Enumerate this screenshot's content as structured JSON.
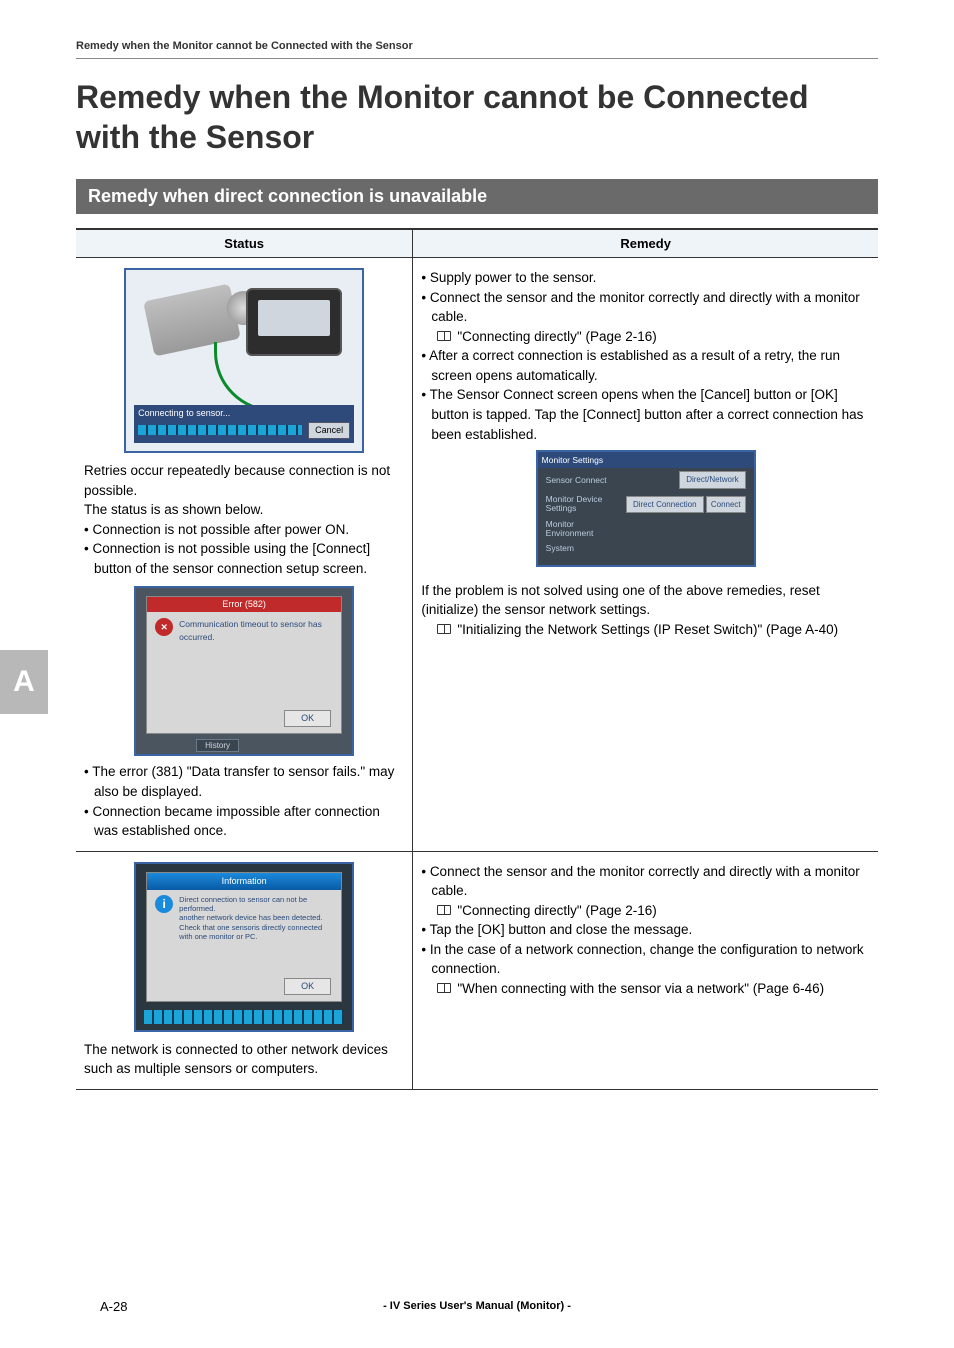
{
  "running_head": "Remedy when the Monitor cannot be Connected with the Sensor",
  "title": "Remedy when the Monitor cannot be Connected with the Sensor",
  "section": "Remedy when direct connection is unavailable",
  "table": {
    "head_status": "Status",
    "head_remedy": "Remedy"
  },
  "row1": {
    "illus1": {
      "connecting": "Connecting to sensor...",
      "cancel": "Cancel"
    },
    "status_p1": "Retries occur repeatedly because connection is not possible.",
    "status_p2": "The status is as shown below.",
    "status_b1": "Connection is not possible after power ON.",
    "status_b2": "Connection is not possible using the [Connect] button of the sensor connection setup screen.",
    "illus2": {
      "title": "Error (582)",
      "msg": "Communication timeout to sensor has occurred.",
      "ok": "OK",
      "history": "History"
    },
    "status_b3": "The error (381) \"Data transfer to sensor fails.\" may also be displayed.",
    "status_b4": "Connection became impossible after connection was established once.",
    "remedy_b1": "Supply power to the sensor.",
    "remedy_b2": "Connect the sensor and the monitor correctly and directly with a monitor cable.",
    "remedy_ref1": "\"Connecting directly\" (Page 2-16)",
    "remedy_b3": "After a correct connection is established as a result of a retry, the run screen opens automatically.",
    "remedy_b4": "The Sensor Connect screen opens when the [Cancel] button or [OK] button is tapped. Tap the [Connect] button after a correct connection has been established.",
    "mset": {
      "title": "Monitor Settings",
      "r1_lbl": "Sensor Connect",
      "r1_val": "Direct/Network",
      "r2_lbl": "Monitor Device Settings",
      "r2_val": "Direct Connection",
      "r2_btn": "Connect",
      "r3_lbl": "Monitor Environment",
      "r4_lbl": "System"
    },
    "remedy_p2": "If the problem is not solved using one of the above remedies, reset (initialize) the sensor network settings.",
    "remedy_ref2": "\"Initializing the Network Settings (IP Reset Switch)\" (Page A-40)"
  },
  "row2": {
    "illus3": {
      "title": "Information",
      "msg": "Direct connection to sensor can not be performed.\nanother network device has been detected.\nCheck that one sensoris directly connected with one monitor or PC.",
      "ok": "OK"
    },
    "status_p1": "The network is connected to other network devices such as multiple sensors or computers.",
    "remedy_b1": "Connect the sensor and the monitor correctly and directly with a monitor cable.",
    "remedy_ref1": "\"Connecting directly\" (Page 2-16)",
    "remedy_b2": "Tap the [OK] button and close the message.",
    "remedy_b3": "In the case of a network connection, change the configuration to network connection.",
    "remedy_ref2": "\"When connecting with the sensor via a network\" (Page 6-46)"
  },
  "side_tab": "A",
  "footer": "- IV Series User's Manual (Monitor) -",
  "page_num": "A-28"
}
